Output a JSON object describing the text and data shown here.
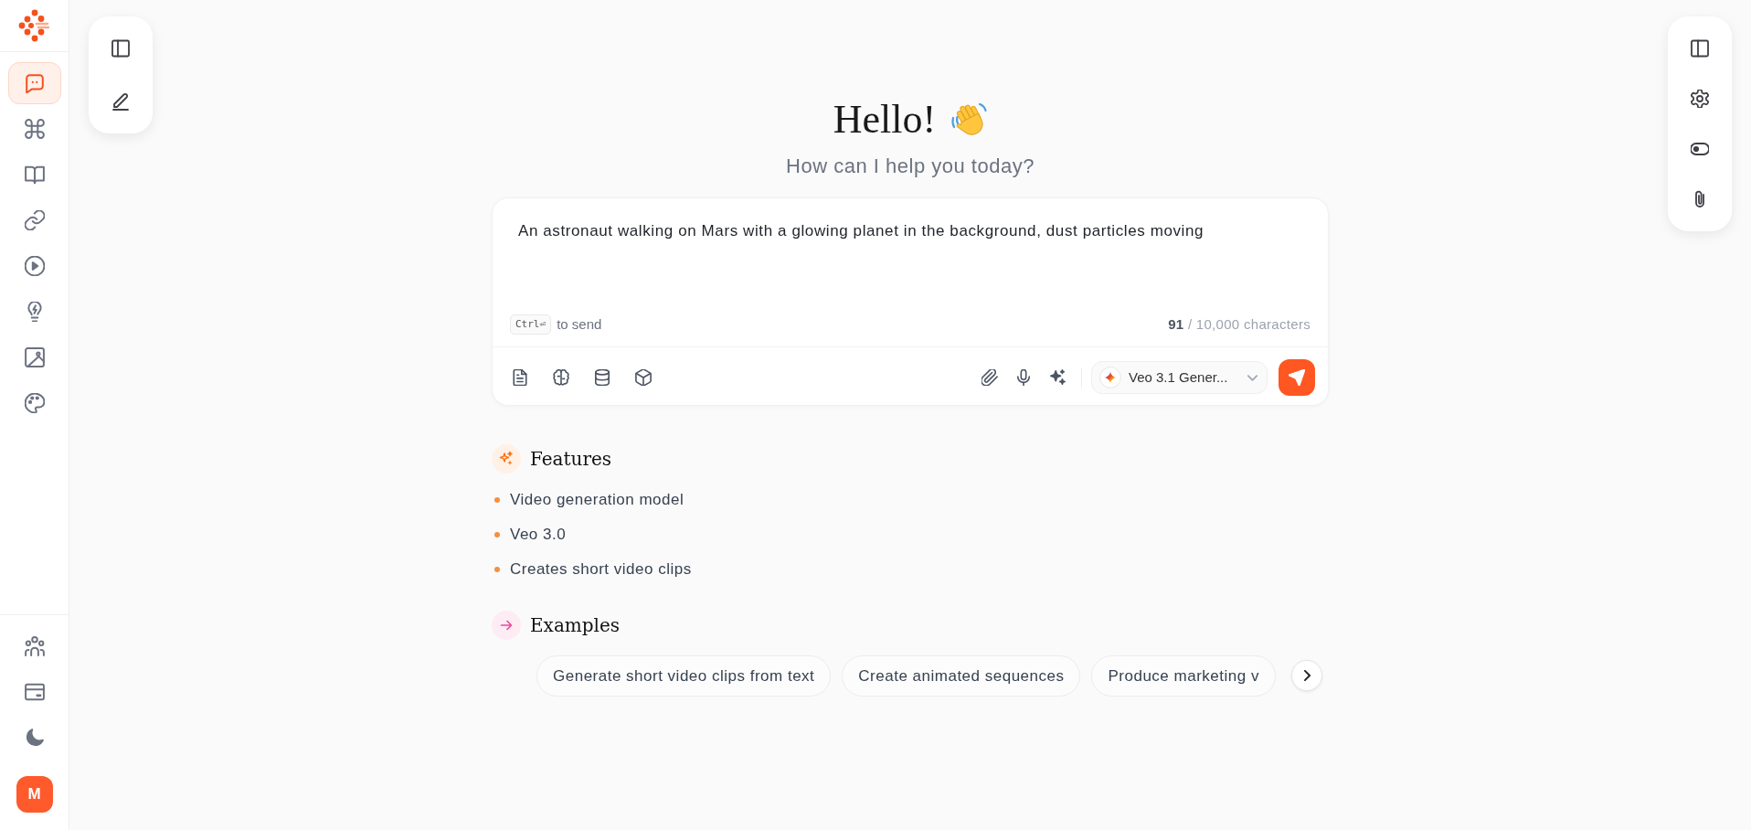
{
  "sidebar": {
    "items": [
      {
        "kind": "chat",
        "selected": true
      },
      {
        "kind": "apps",
        "selected": false
      },
      {
        "kind": "library",
        "selected": false
      },
      {
        "kind": "integrations",
        "selected": false
      },
      {
        "kind": "video",
        "selected": false
      },
      {
        "kind": "ideas",
        "selected": false
      },
      {
        "kind": "images",
        "selected": false
      },
      {
        "kind": "palette",
        "selected": false
      }
    ],
    "footer_items": [
      {
        "kind": "team"
      },
      {
        "kind": "billing"
      },
      {
        "kind": "dark-mode"
      }
    ],
    "avatar_initial": "M"
  },
  "left_toolbar": [
    {
      "kind": "sidebar"
    },
    {
      "kind": "new-chat"
    }
  ],
  "right_toolbar": [
    {
      "kind": "panel"
    },
    {
      "kind": "settings"
    },
    {
      "kind": "toggle"
    },
    {
      "kind": "attach"
    }
  ],
  "greeting": {
    "title": "Hello!",
    "subtitle": "How can I help you today?"
  },
  "composer": {
    "value": "An astronaut walking on Mars with a glowing planet in the background, dust particles moving",
    "shortcut_key": "Ctrl⏎",
    "shortcut_hint": "to send",
    "counter": "**91** / 10,000 characters",
    "tools": [
      {
        "kind": "document"
      },
      {
        "kind": "brain"
      },
      {
        "kind": "database"
      },
      {
        "kind": "cube"
      }
    ],
    "actions": [
      {
        "kind": "attach-small"
      },
      {
        "kind": "mic"
      },
      {
        "kind": "sparkles"
      }
    ],
    "model": "Veo 3.1 Gener..."
  },
  "features": {
    "title": "Features",
    "items": [
      "Video generation model",
      "Veo 3.0",
      "Creates short video clips"
    ]
  },
  "examples": {
    "title": "Examples",
    "items": [
      "Generate short video clips from text",
      "Create animated sequences",
      "Produce marketing v"
    ]
  }
}
